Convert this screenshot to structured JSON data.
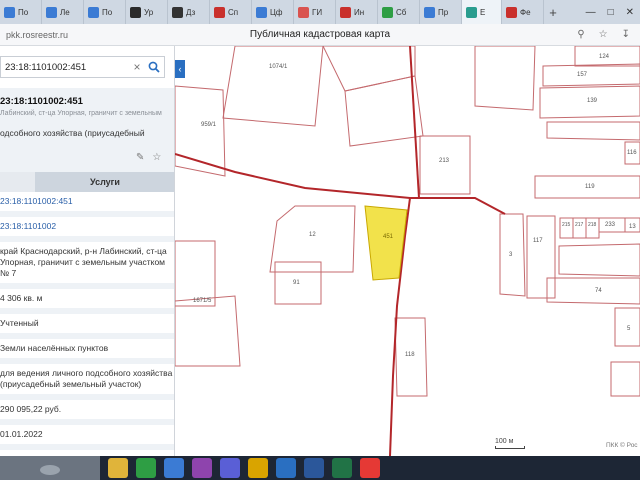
{
  "browser": {
    "tabs": [
      {
        "label": "По",
        "color": "#3b7bd4"
      },
      {
        "label": "Ле",
        "color": "#3b7bd4"
      },
      {
        "label": "По",
        "color": "#3b7bd4"
      },
      {
        "label": "Ур",
        "color": "#2b2b2b"
      },
      {
        "label": "Дз",
        "color": "#333333"
      },
      {
        "label": "Сп",
        "color": "#c9302c"
      },
      {
        "label": "Цф",
        "color": "#3b7bd4"
      },
      {
        "label": "ГИ",
        "color": "#d9534f"
      },
      {
        "label": "Ин",
        "color": "#c9302c"
      },
      {
        "label": "Сб",
        "color": "#2e9e44"
      },
      {
        "label": "Пр",
        "color": "#3b7bd4"
      },
      {
        "label": "Е",
        "color": "#2a9d8f"
      },
      {
        "label": "Фе",
        "color": "#c9302c"
      }
    ],
    "new_tab": "+",
    "url": "pkk.rosreestr.ru",
    "page_title": "Публичная кадастровая карта"
  },
  "panel": {
    "search_value": "23:18:1101002:451",
    "object_number": "23:18:1101002:451",
    "object_subtitle": "Лабинский, ст-ца Упорная, граничит с земельным",
    "object_use_line1": "одсобного хозяйства (приусадебный",
    "tab_info": "",
    "tab_services": "Услуги",
    "rows": [
      {
        "text": "23:18:1101002:451",
        "style": "blue"
      },
      {
        "text": "23:18:1101002",
        "style": "blue"
      },
      {
        "text": "край Краснодарский, р-н Лабинский, ст-ца Упорная, граничит с земельным участком № 7",
        "style": "normal"
      },
      {
        "text": "4 306 кв. м",
        "style": "normal"
      },
      {
        "text": "Учтенный",
        "style": "normal"
      },
      {
        "text": "Земли населённых пунктов",
        "style": "normal"
      },
      {
        "text": "для ведения личного подсобного хозяйства (приусадебный земельный участок)",
        "style": "normal"
      },
      {
        "text": "290 095,22 руб.",
        "style": "normal"
      },
      {
        "text": "01.01.2022",
        "style": "normal"
      }
    ]
  },
  "map": {
    "parcels": [
      {
        "label": "1074/1"
      },
      {
        "label": "959/1"
      },
      {
        "label": "124"
      },
      {
        "label": "157"
      },
      {
        "label": "139"
      },
      {
        "label": "116"
      },
      {
        "label": "213"
      },
      {
        "label": "119"
      },
      {
        "label": "12"
      },
      {
        "label": "451"
      },
      {
        "label": "91"
      },
      {
        "label": "1671/5"
      },
      {
        "label": "3"
      },
      {
        "label": "117"
      },
      {
        "label": "215"
      },
      {
        "label": "217"
      },
      {
        "label": "218"
      },
      {
        "label": "233"
      },
      {
        "label": "74"
      },
      {
        "label": "118"
      },
      {
        "label": "5"
      },
      {
        "label": "13"
      }
    ],
    "highlight_color": "#f2e24b",
    "boundary_color": "#b3262a",
    "scale_label": "100 м",
    "attribution": "ПКК © Рос"
  },
  "taskbar": {
    "start_label": "",
    "apps": [
      "folder-icon",
      "chrome-icon",
      "store-icon",
      "people-icon",
      "calendar-icon",
      "notes-icon",
      "mail-icon",
      "word-icon",
      "excel-icon",
      "yandex-icon"
    ]
  }
}
